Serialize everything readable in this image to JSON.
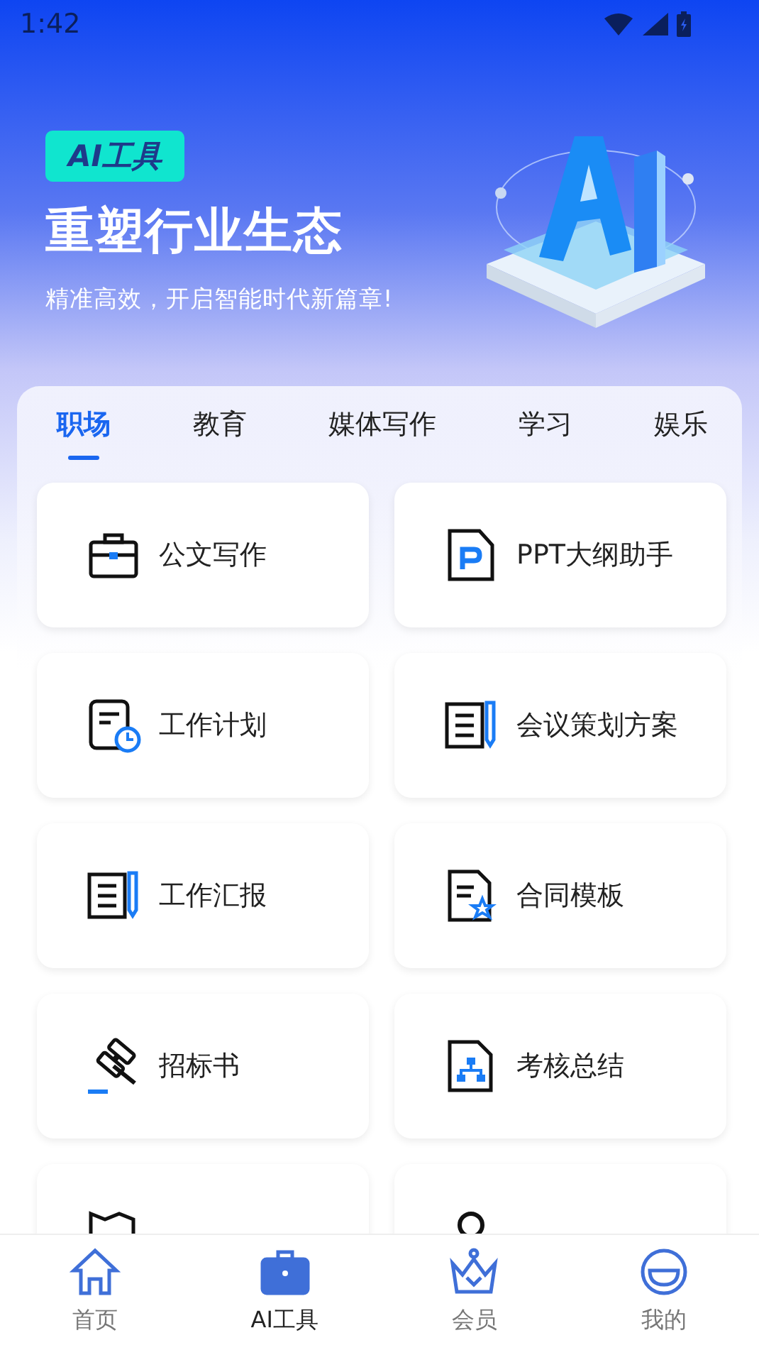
{
  "status_bar": {
    "time": "1:42"
  },
  "hero": {
    "badge": "AI工具",
    "title": "重塑行业生态",
    "subtitle": "精准高效，开启智能时代新篇章!"
  },
  "tabs": [
    {
      "label": "职场",
      "selected": true
    },
    {
      "label": "教育",
      "selected": false
    },
    {
      "label": "媒体写作",
      "selected": false
    },
    {
      "label": "学习",
      "selected": false
    },
    {
      "label": "娱乐",
      "selected": false
    }
  ],
  "tools": [
    {
      "kind": "briefcase",
      "label": "公文写作"
    },
    {
      "kind": "ppt",
      "label": "PPT大纲助手"
    },
    {
      "kind": "plan",
      "label": "工作计划"
    },
    {
      "kind": "notepen",
      "label": "会议策划方案"
    },
    {
      "kind": "notepen",
      "label": "工作汇报"
    },
    {
      "kind": "contract",
      "label": "合同模板"
    },
    {
      "kind": "gavel",
      "label": "招标书"
    },
    {
      "kind": "orgdoc",
      "label": "考核总结"
    },
    {
      "kind": "rectify"
    },
    {
      "kind": "person"
    }
  ],
  "bottom_nav": [
    {
      "kind": "home",
      "label": "首页",
      "selected": false
    },
    {
      "kind": "toolbox",
      "label": "AI工具",
      "selected": true
    },
    {
      "kind": "crown",
      "label": "会员",
      "selected": false
    },
    {
      "kind": "face",
      "label": "我的",
      "selected": false
    }
  ]
}
